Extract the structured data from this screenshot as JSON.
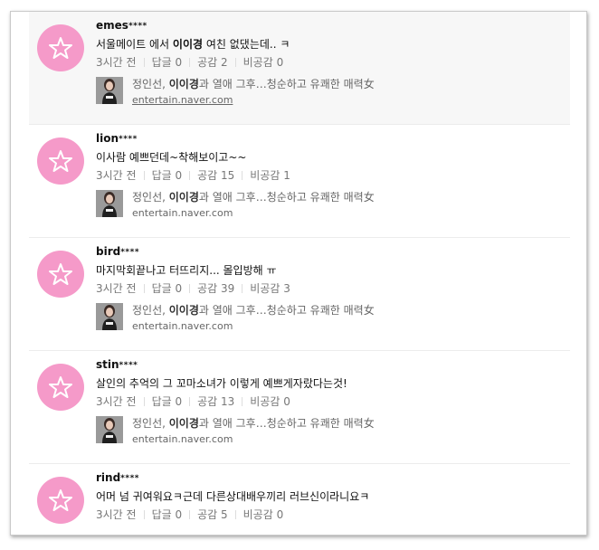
{
  "comments": [
    {
      "nick": "emes",
      "mask": "****",
      "text_before": "서울메이트 에서 ",
      "text_bold": "이이경",
      "text_after": " 여친 없댔는데.. ㅋ",
      "time": "3시간 전",
      "reply": "답글 0",
      "like": "공감 2",
      "dislike": "비공감 0",
      "news_before": "정인선, ",
      "news_bold": "이이경",
      "news_after": "과 열애 그후…청순하고 유쾌한 매력女",
      "news_url": "entertain.naver.com",
      "highlighted": true
    },
    {
      "nick": "lion",
      "mask": "****",
      "text_before": "이사람 예쁘던데~착해보이고~~",
      "text_bold": "",
      "text_after": "",
      "time": "3시간 전",
      "reply": "답글 0",
      "like": "공감 15",
      "dislike": "비공감 1",
      "news_before": "정인선, ",
      "news_bold": "이이경",
      "news_after": "과 열애 그후…청순하고 유쾌한 매력女",
      "news_url": "entertain.naver.com",
      "highlighted": false
    },
    {
      "nick": "bird",
      "mask": "****",
      "text_before": "마지막회끝나고 터뜨리지... 몰입방해 ㅠ",
      "text_bold": "",
      "text_after": "",
      "time": "3시간 전",
      "reply": "답글 0",
      "like": "공감 39",
      "dislike": "비공감 3",
      "news_before": "정인선, ",
      "news_bold": "이이경",
      "news_after": "과 열애 그후…청순하고 유쾌한 매력女",
      "news_url": "entertain.naver.com",
      "highlighted": false
    },
    {
      "nick": "stin",
      "mask": "****",
      "text_before": "살인의 추억의 그 꼬마소녀가 이렇게 예쁘게자랐다는것!",
      "text_bold": "",
      "text_after": "",
      "time": "3시간 전",
      "reply": "답글 0",
      "like": "공감 13",
      "dislike": "비공감 0",
      "news_before": "정인선, ",
      "news_bold": "이이경",
      "news_after": "과 열애 그후…청순하고 유쾌한 매력女",
      "news_url": "entertain.naver.com",
      "highlighted": false
    },
    {
      "nick": "rind",
      "mask": "****",
      "text_before": "어머 넘 귀여워요ㅋ근데 다른상대배우끼리 러브신이라니요ㅋ",
      "text_bold": "",
      "text_after": "",
      "time": "3시간 전",
      "reply": "답글 0",
      "like": "공감 5",
      "dislike": "비공감 0",
      "news_before": "",
      "news_bold": "",
      "news_after": "",
      "news_url": "",
      "highlighted": false
    }
  ],
  "icons": {
    "avatar": "star-icon",
    "thumb": "news-thumbnail"
  },
  "colors": {
    "avatar_bg": "#f59ac9",
    "highlight_bg": "#f7f7f7"
  }
}
